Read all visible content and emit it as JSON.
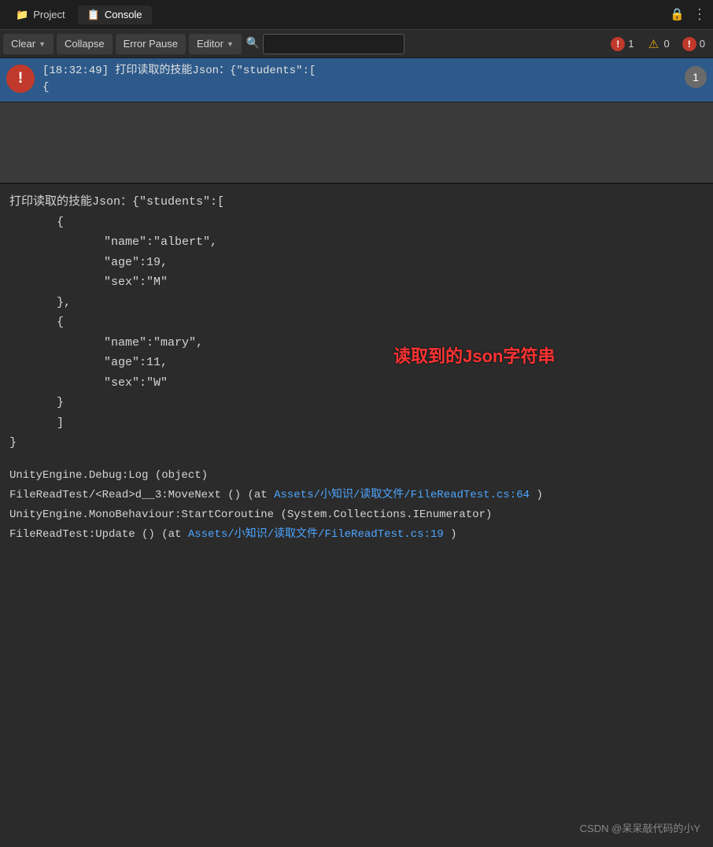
{
  "titleBar": {
    "projectTab": "Project",
    "consoleTab": "Console",
    "projectIcon": "📁",
    "consoleIcon": "📋"
  },
  "toolbar": {
    "clearLabel": "Clear",
    "collapseLabel": "Collapse",
    "errorPauseLabel": "Error Pause",
    "editorLabel": "Editor",
    "searchPlaceholder": "",
    "errorCount": "1",
    "warnCount": "0",
    "infoCount": "0"
  },
  "consoleEntry": {
    "timestamp": "[18:32:49]",
    "messageShort": "打印读取的技能Json：{\"students\":[",
    "messageLine2": "    {",
    "count": "1"
  },
  "consoleDetail": {
    "line1": "打印读取的技能Json：{\"students\":[",
    "line2": "    {",
    "line3": "        \"name\":\"albert\",",
    "line4": "        \"age\":19,",
    "line5": "        \"sex\":\"M\"",
    "line6": "    },",
    "line7": "    {",
    "line8": "        \"name\":\"mary\",",
    "line9": "        \"age\":11,",
    "line10": "        \"sex\":\"W\"",
    "line11": "    }",
    "line12": "    ]",
    "line13": "}"
  },
  "annotation": "读取到的Json字符串",
  "stackTrace": {
    "line1": "UnityEngine.Debug:Log (object)",
    "line2": "FileReadTest/<Read>d__3:MoveNext () (at",
    "link1": "Assets/小知识/读取文件/FileReadTest.cs:64",
    "line3close": ")",
    "line4": "UnityEngine.MonoBehaviour:StartCoroutine (System.Collections.IEnumerator)",
    "line5": "FileReadTest:Update () (at",
    "link2": "Assets/小知识/读取文件/FileReadTest.cs:19",
    "line5close": ")"
  },
  "footer": {
    "credit": "CSDN @呆呆敲代码的小Y"
  }
}
